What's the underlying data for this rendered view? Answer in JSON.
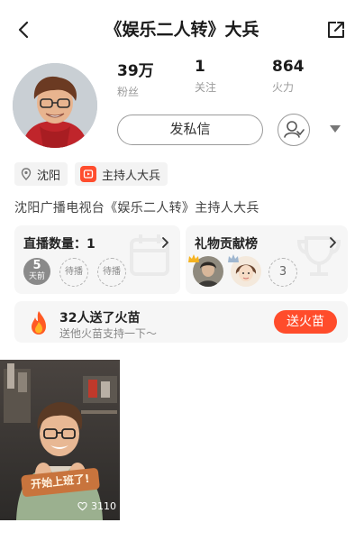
{
  "header": {
    "title": "《娱乐二人转》大兵"
  },
  "stats": [
    {
      "value": "39万",
      "label": "粉丝"
    },
    {
      "value": "1",
      "label": "关注"
    },
    {
      "value": "864",
      "label": "火力"
    }
  ],
  "actions": {
    "message_label": "发私信"
  },
  "tags": {
    "location": "沈阳",
    "role": "主持人大兵"
  },
  "bio": "沈阳广播电视台《娱乐二人转》主持人大兵",
  "live_card": {
    "title": "直播数量：1",
    "day_number": "5",
    "day_text": "天前",
    "pending_1": "待播",
    "pending_2": "待播"
  },
  "gift_card": {
    "title": "礼物贡献榜",
    "more_count": "3"
  },
  "fire_card": {
    "title": "32人送了火苗",
    "subtitle": "送他火苗支持一下～",
    "button": "送火苗"
  },
  "video": {
    "overlay_text": "开始上班了!",
    "likes": "3110"
  },
  "colors": {
    "accent": "#ff4c2b",
    "card_bg": "#f6f6f6"
  }
}
